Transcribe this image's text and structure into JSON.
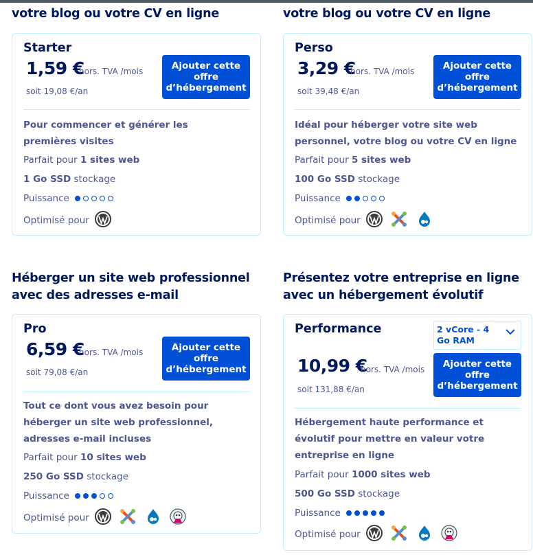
{
  "colors": {
    "accent": "#0050d7",
    "heading": "#00185e",
    "text": "#4d5693",
    "border": "#bef1ff"
  },
  "icons": [
    "wordpress-icon",
    "joomla-icon",
    "drupal-icon",
    "prestashop-icon",
    "chevron-down-icon"
  ],
  "sections": [
    {
      "heading": "votre blog ou votre CV en ligne",
      "plan": "Starter",
      "price": "1,59 €",
      "price_note": "hors. TVA /mois",
      "yearly": "soit 19,08 €/an",
      "cta": "Ajouter cette offre d’hébergement",
      "description": "Pour commencer et générer les premières visites",
      "sites_prefix": "Parfait pour ",
      "sites": "1 sites web",
      "storage": "1 Go SSD",
      "storage_suffix": " stockage",
      "power_label": "Puissance",
      "power": 1,
      "optimized_label": "Optimisé pour"
    },
    {
      "heading": "votre blog ou votre CV en ligne",
      "plan": "Perso",
      "price": "3,29 €",
      "price_note": "hors. TVA /mois",
      "yearly": "soit 39,48 €/an",
      "cta": "Ajouter cette offre d’hébergement",
      "description": "Idéal pour héberger votre site web personnel, votre blog ou votre CV en ligne",
      "sites_prefix": "Parfait pour ",
      "sites": "5 sites web",
      "storage": "100 Go SSD",
      "storage_suffix": " stockage",
      "power_label": "Puissance",
      "power": 2,
      "optimized_label": "Optimisé pour"
    },
    {
      "heading": "Héberger un site web professionnel avec des adresses e-mail",
      "plan": "Pro",
      "price": "6,59 €",
      "price_note": "hors. TVA /mois",
      "yearly": "soit 79,08 €/an",
      "cta": "Ajouter cette offre d’hébergement",
      "description": "Tout ce dont vous avez besoin pour héberger un site web professionnel, adresses e-mail incluses",
      "sites_prefix": "Parfait pour ",
      "sites": "10 sites web",
      "storage": "250 Go SSD",
      "storage_suffix": " stockage",
      "power_label": "Puissance",
      "power": 3,
      "optimized_label": "Optimisé pour"
    },
    {
      "heading": "Présentez votre entreprise en ligne avec un hébergement évolutif",
      "plan": "Performance",
      "select_value": "2 vCore - 4 Go RAM",
      "price": "10,99 €",
      "price_note": "hors. TVA /mois",
      "yearly": "soit 131,88 €/an",
      "cta": "Ajouter cette offre d’hébergement",
      "description": "Hébergement haute performance et évolutif pour mettre en valeur votre entreprise en ligne",
      "sites_prefix": "Parfait pour ",
      "sites": "1000 sites web",
      "storage": "500 Go SSD",
      "storage_suffix": " stockage",
      "power_label": "Puissance",
      "power": 5,
      "optimized_label": "Optimisé pour"
    }
  ]
}
